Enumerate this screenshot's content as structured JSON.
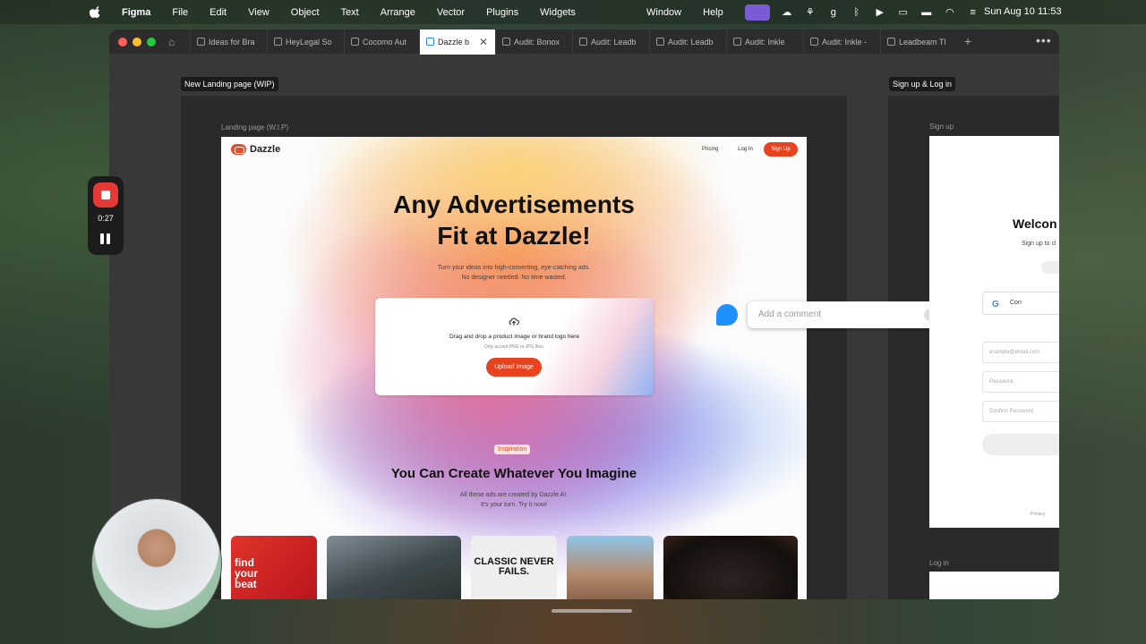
{
  "menubar": {
    "app": "Figma",
    "items": [
      "File",
      "Edit",
      "View",
      "Object",
      "Text",
      "Arrange",
      "Vector",
      "Plugins",
      "Widgets"
    ],
    "right_items": [
      "Window",
      "Help"
    ],
    "clock": "Sun Aug 10  11:53"
  },
  "tabs": [
    {
      "label": "Ideas for Bra"
    },
    {
      "label": "HeyLegal So"
    },
    {
      "label": "Cocomo Aut"
    },
    {
      "label": "Dazzle b",
      "active": true
    },
    {
      "label": "Audit: Bonox"
    },
    {
      "label": "Audit: Leadb"
    },
    {
      "label": "Audit: Leadb"
    },
    {
      "label": "Audit: Inkle"
    },
    {
      "label": "Audit: Inkle -"
    },
    {
      "label": "Leadbeam Tl"
    }
  ],
  "canvas": {
    "frame1_label": "New Landing page (WIP)",
    "frame2_label": "Sign up & Log in",
    "subframe1": "Landing page (W.I.P)",
    "subframe2": "Sign up",
    "subframe3": "Log in"
  },
  "landing": {
    "brand": "Dazzle",
    "nav_pricing": "Pricing",
    "nav_login": "Log In",
    "nav_signup": "Sign Up",
    "hero_line1": "Any Advertisements",
    "hero_line2": "Fit at Dazzle!",
    "tagline1": "Turn your ideas into high-converting, eye-catching ads.",
    "tagline2": "No designer needed. No time wasted.",
    "upload_title": "Drag and drop a product image or brand logo here",
    "upload_sub": "Only accept PNG or JPG files.",
    "upload_button": "Upload Image",
    "inspiration_tag": "Inspiration",
    "section_title": "You Can Create Whatever You Imagine",
    "section_sub1": "All these ads are created by Dazzle AI.",
    "section_sub2": "It's your turn. Try it now!",
    "card1_text": "find your beat",
    "card3_text": "CLASSIC NEVER FAILS."
  },
  "comment": {
    "placeholder": "Add a comment"
  },
  "signup": {
    "welcome": "Welcon",
    "sub": "Sign up to cl",
    "google": "Con",
    "email_placeholder": "example@email.com",
    "password_placeholder": "Password",
    "confirm_placeholder": "Confirm Password",
    "privacy": "Privacy"
  },
  "recorder": {
    "time": "0:27"
  },
  "colors": {
    "accent": "#e8431f",
    "figma_purple": "#7c5cd6",
    "comment_blue": "#1e90ff"
  }
}
